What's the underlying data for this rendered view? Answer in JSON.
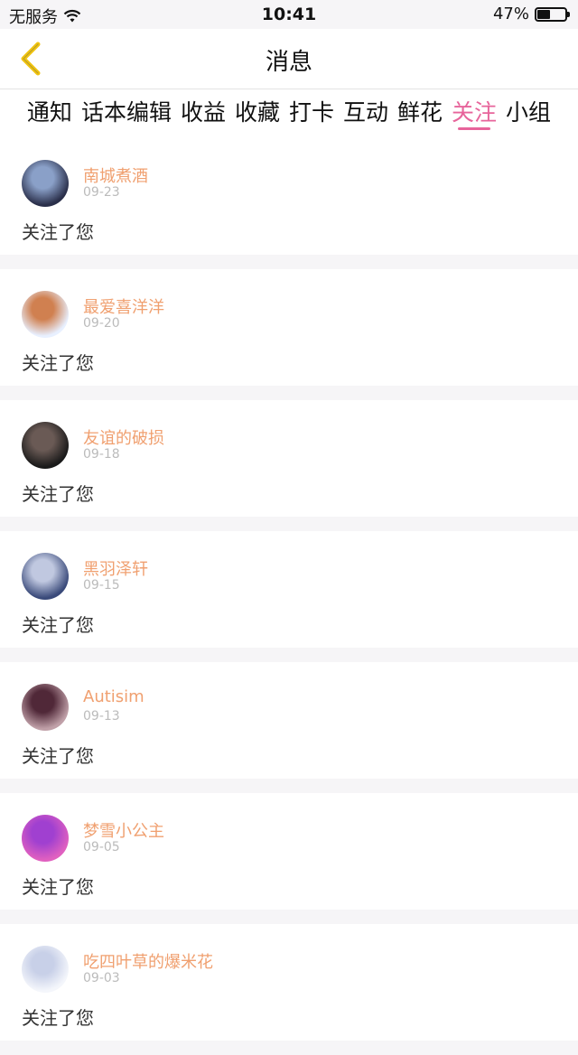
{
  "status_bar": {
    "carrier": "无服务",
    "time": "10:41",
    "battery": "47%",
    "battery_level": 0.47
  },
  "nav": {
    "title": "消息",
    "back_icon": "chevron-left-icon",
    "accent_color": "#f1c40f"
  },
  "tabs": [
    {
      "label": "通知"
    },
    {
      "label": "话本编辑"
    },
    {
      "label": "收益"
    },
    {
      "label": "收藏"
    },
    {
      "label": "打卡"
    },
    {
      "label": "互动"
    },
    {
      "label": "鲜花"
    },
    {
      "label": "关注",
      "active": true
    },
    {
      "label": "小组"
    }
  ],
  "active_color": "#e7649b",
  "messages": [
    {
      "name": "南城煮酒",
      "date": "09-23",
      "text": "关注了您",
      "avatar_colors": [
        "#2a2f4a",
        "#8aa0c8"
      ]
    },
    {
      "name": "最爱喜洋洋",
      "date": "09-20",
      "text": "关注了您",
      "avatar_colors": [
        "#e8f0ff",
        "#d08050"
      ]
    },
    {
      "name": "友谊的破损",
      "date": "09-18",
      "text": "关注了您",
      "avatar_colors": [
        "#1a1a1a",
        "#6a5a55"
      ]
    },
    {
      "name": "黑羽泽轩",
      "date": "09-15",
      "text": "关注了您",
      "avatar_colors": [
        "#3a4a7a",
        "#c0c8e0"
      ]
    },
    {
      "name": "Autisim",
      "date": "09-13",
      "text": "关注了您",
      "avatar_colors": [
        "#c0a0a8",
        "#502838"
      ]
    },
    {
      "name": "梦雪小公主",
      "date": "09-05",
      "text": "关注了您",
      "avatar_colors": [
        "#e060c0",
        "#a040d0"
      ]
    },
    {
      "name": "吃四叶草的爆米花",
      "date": "09-03",
      "text": "关注了您",
      "avatar_colors": [
        "#f4f6fb",
        "#c8d0e8"
      ]
    }
  ]
}
